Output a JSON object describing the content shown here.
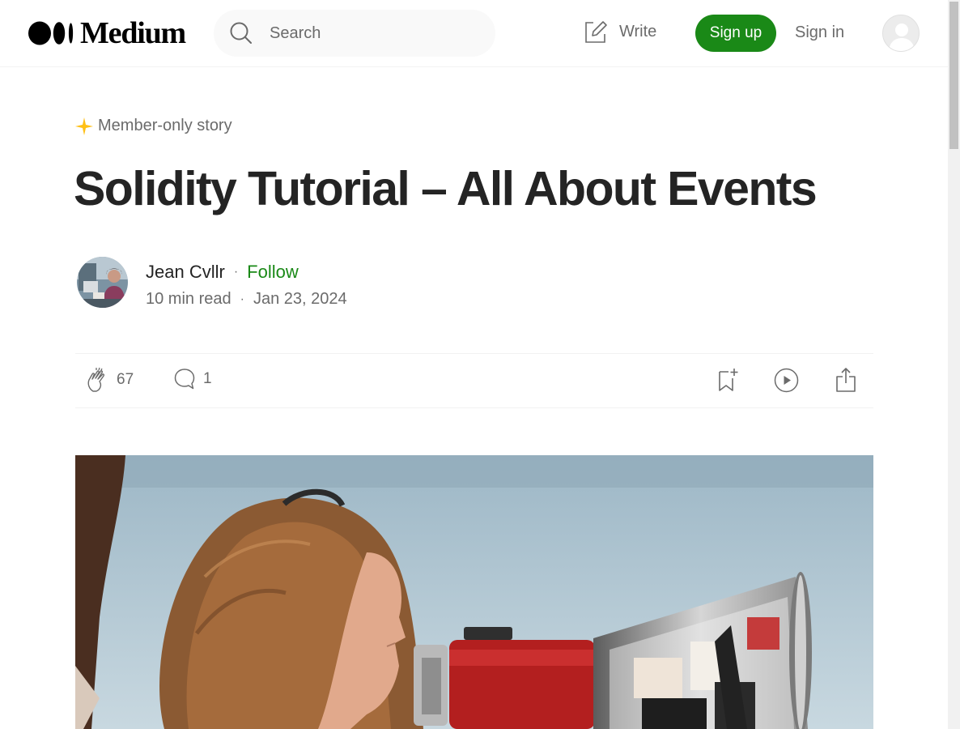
{
  "header": {
    "logo_text": "Medium",
    "search_placeholder": "Search",
    "write_label": "Write",
    "signup_label": "Sign up",
    "signin_label": "Sign in"
  },
  "article": {
    "badge": "Member-only story",
    "title": "Solidity Tutorial – All About Events",
    "author": "Jean Cvllr",
    "separator": "·",
    "follow_label": "Follow",
    "read_time": "10 min read",
    "date": "Jan 23, 2024",
    "claps": "67",
    "comments": "1"
  },
  "colors": {
    "brand_green": "#1a8917",
    "star_yellow": "#ffc017",
    "text_primary": "#242424",
    "text_secondary": "#6b6b6b"
  },
  "icons": [
    "medium-logo-icon",
    "search-icon",
    "write-icon",
    "user-avatar-icon",
    "sparkle-icon",
    "clap-icon",
    "comment-icon",
    "bookmark-add-icon",
    "play-icon",
    "share-icon"
  ]
}
